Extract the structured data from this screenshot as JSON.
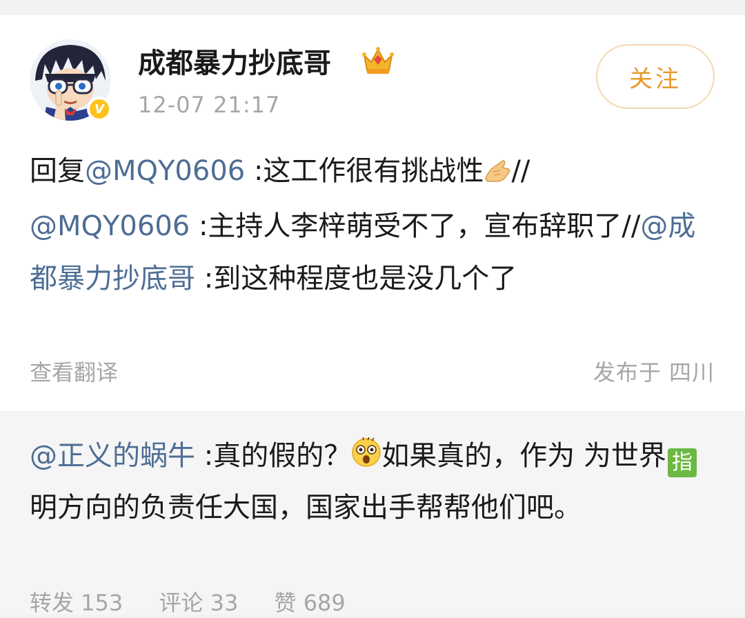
{
  "post": {
    "author": {
      "name": "成都暴力抄底哥",
      "verified_badge": "V",
      "avatar_icon": "anime-boy-avatar",
      "vip_icon": "crown-icon"
    },
    "timestamp": "12-07 21:17",
    "follow_label": "关注",
    "body": {
      "p1": "回复",
      "m1": "@MQY0606",
      "p2": " :这工作很有挑战性",
      "emoji1": "thumbs-up-emoji",
      "p3": "//",
      "m2": "@MQY0606",
      "p4": " :主持人李梓萌受不了，宣布辞职了//",
      "m3": "@成都暴力抄底哥",
      "p5": " :到这种程度也是没几个了"
    },
    "translate_label": "查看翻译",
    "location": "发布于 四川"
  },
  "repost": {
    "mention": "@正义的蜗牛",
    "p1": " :真的假的？",
    "emoji": "shocked-face-emoji",
    "p2": "如果真的，作为 为世界",
    "zhi": "指",
    "p3": "明方向的负责任大国，国家出手帮帮他们吧。",
    "stats": {
      "repost": "转发 153",
      "comment": "评论 33",
      "like": "赞 689"
    }
  },
  "colors": {
    "mention": "#4e6d94",
    "follow": "#e69a2a",
    "badge": "#ffc21a",
    "secondary_text": "#a6a6a6"
  }
}
